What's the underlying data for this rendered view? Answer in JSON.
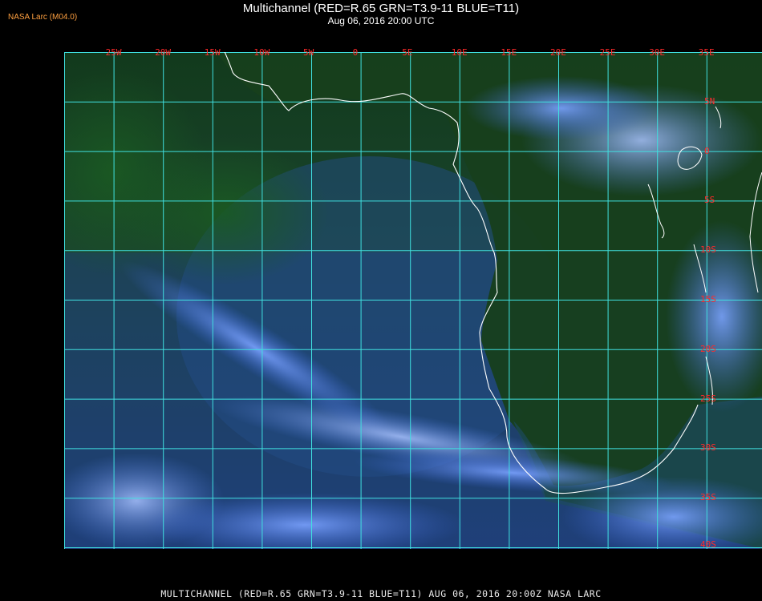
{
  "badge": "NASA Larc (M04.0)",
  "title": {
    "line1": "Multichannel (RED=R.65 GRN=T3.9-11 BLUE=T11)",
    "line2": "Aug 06, 2016 20:00 UTC"
  },
  "map": {
    "lon_labels": [
      "25W",
      "20W",
      "15W",
      "10W",
      "5W",
      "0",
      "5E",
      "10E",
      "15E",
      "20E",
      "25E",
      "30E",
      "35E"
    ],
    "lat_labels": [
      "5N",
      "0",
      "5S",
      "10S",
      "15S",
      "20S",
      "25S",
      "30S",
      "35S",
      "40S"
    ],
    "colors": {
      "grid": "#40e0e0",
      "coast": "#ffffff",
      "label": "#ff2a2a",
      "land": "#1e4620",
      "ocean": "#1f3f7a",
      "cloud": "#4d80e8"
    }
  },
  "footer": "MULTICHANNEL (RED=R.65 GRN=T3.9-11 BLUE=T11) AUG 06, 2016 20:00Z   NASA LARC"
}
